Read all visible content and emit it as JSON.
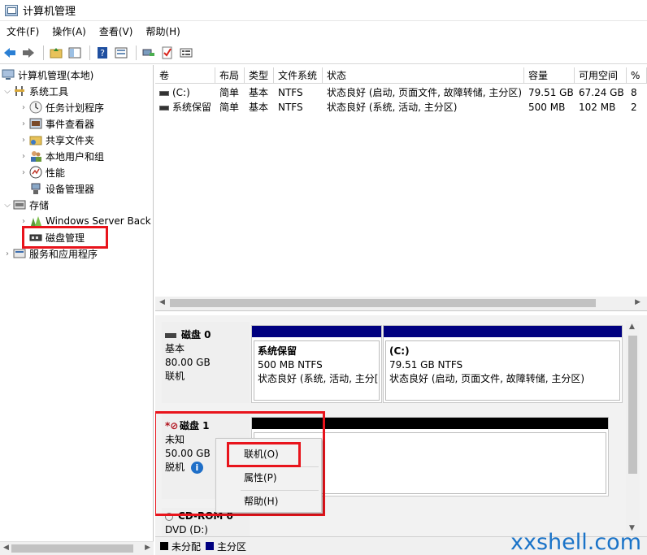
{
  "window": {
    "title": "计算机管理"
  },
  "menu": [
    "文件(F)",
    "操作(A)",
    "查看(V)",
    "帮助(H)"
  ],
  "toolbar": {
    "buttons": [
      "back-icon",
      "forward-icon",
      "up-folder-icon",
      "show-hide-tree-icon",
      "help-icon",
      "properties-icon",
      "connect-icon",
      "check-icon",
      "list-icon"
    ]
  },
  "tree": {
    "root": "计算机管理(本地)",
    "system_tools": "系统工具",
    "task_scheduler": "任务计划程序",
    "event_viewer": "事件查看器",
    "shared_folders": "共享文件夹",
    "local_users": "本地用户和组",
    "performance": "性能",
    "device_manager": "设备管理器",
    "storage": "存储",
    "windows_server_backup": "Windows Server Back",
    "disk_management": "磁盘管理",
    "services_apps": "服务和应用程序"
  },
  "volumes": {
    "columns": [
      "卷",
      "布局",
      "类型",
      "文件系统",
      "状态",
      "容量",
      "可用空间",
      "%"
    ],
    "rows": [
      {
        "volume": "(C:)",
        "layout": "简单",
        "type": "基本",
        "fs": "NTFS",
        "status": "状态良好 (启动, 页面文件, 故障转储, 主分区)",
        "capacity": "79.51 GB",
        "free": "67.24 GB",
        "pct": "8"
      },
      {
        "volume": "系统保留",
        "layout": "简单",
        "type": "基本",
        "fs": "NTFS",
        "status": "状态良好 (系统, 活动, 主分区)",
        "capacity": "500 MB",
        "free": "102 MB",
        "pct": "2"
      }
    ]
  },
  "disks": {
    "disk0": {
      "name": "磁盘 0",
      "type": "基本",
      "size": "80.00 GB",
      "state": "联机",
      "partitions": [
        {
          "name": "系统保留",
          "size": "500 MB NTFS",
          "status": "状态良好 (系统, 活动, 主分["
        },
        {
          "name": "(C:)",
          "size": "79.51 GB NTFS",
          "status": "状态良好 (启动, 页面文件, 故障转储, 主分区)"
        }
      ]
    },
    "disk1": {
      "name": "磁盘 1",
      "type": "未知",
      "size": "50.00 GB",
      "state": "脱机"
    },
    "cdrom0": {
      "name": "CD-ROM 0",
      "type": "DVD (D:)"
    }
  },
  "context_menu": {
    "online": "联机(O)",
    "properties": "属性(P)",
    "help": "帮助(H)"
  },
  "legend": {
    "unallocated": "未分配",
    "primary": "主分区",
    "colors": {
      "unallocated": "#000000",
      "primary": "#000080"
    }
  },
  "watermark": "xxshell.com",
  "colors": {
    "highlight": "#e8141c",
    "partition_bar": "#000080"
  }
}
